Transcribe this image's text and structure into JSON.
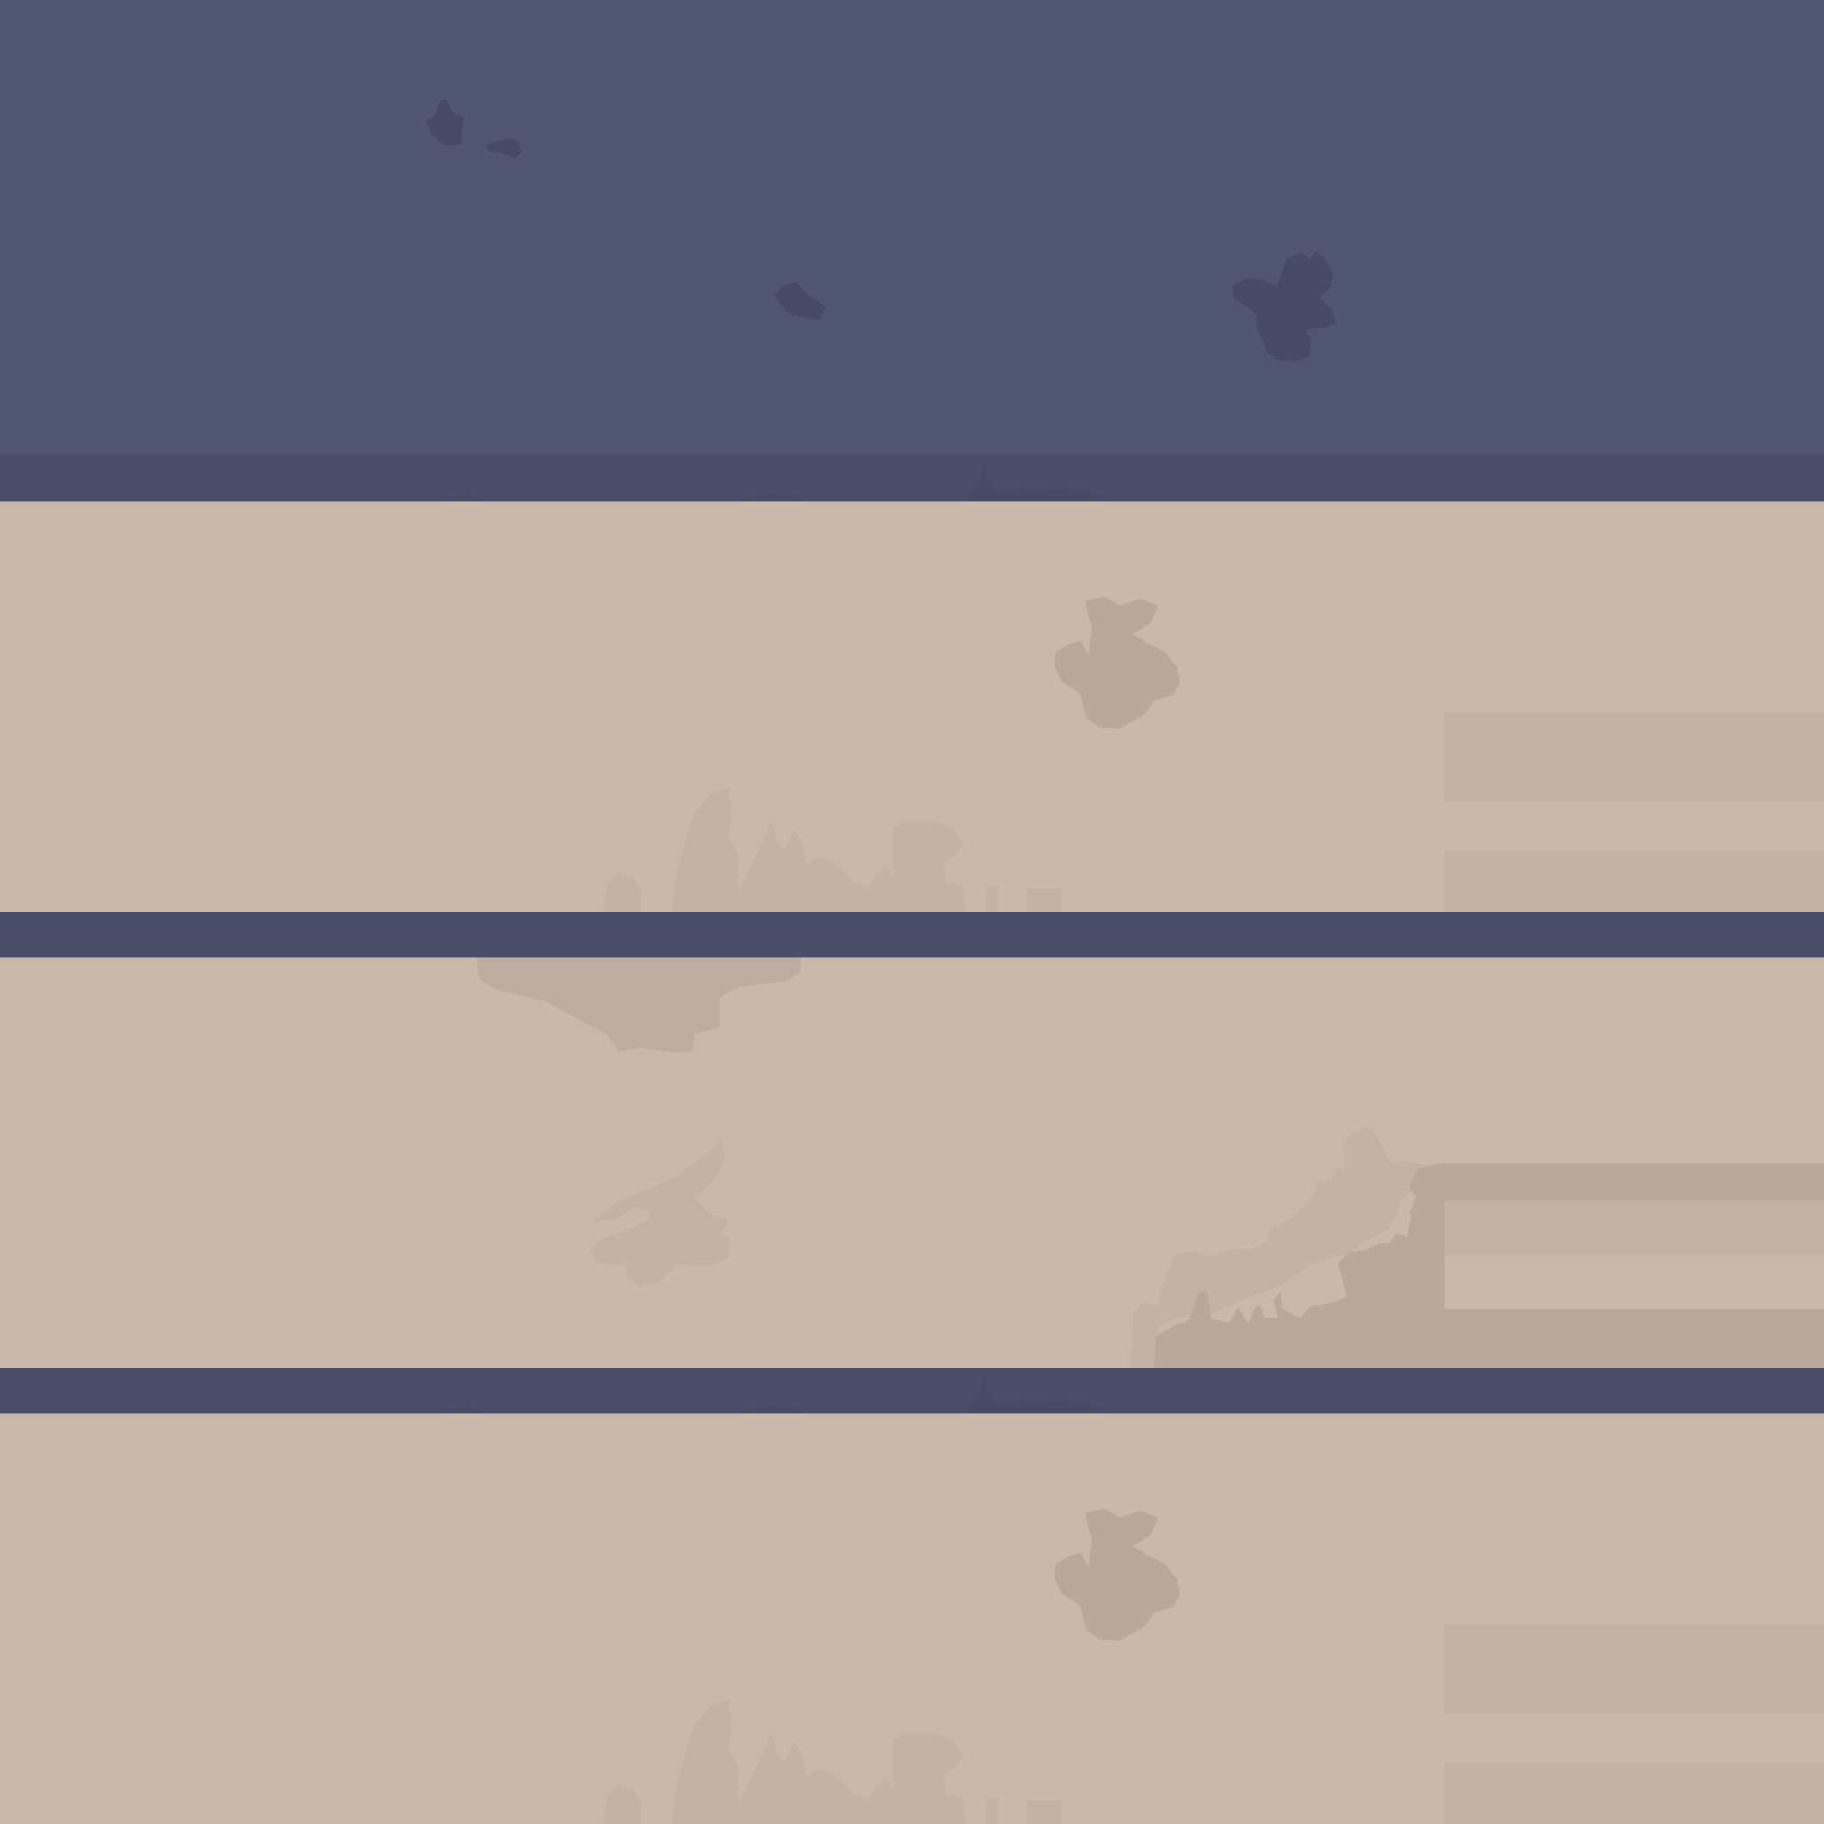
{
  "scene": {
    "type": "tiled-background-texture",
    "palette": {
      "sky": "#51566f",
      "sky_band": "#4b4d69",
      "sky_shadow": "#474a63",
      "sand": "#c9b9ab",
      "sand_shadow": "#bdada0",
      "sand_stripe": "#c3b2a5",
      "rock": "#baa99b"
    },
    "tiles": [
      "sky-tile",
      "sand-tile",
      "sand-tile",
      "sand-tile"
    ],
    "elements": [
      "sky-cloud",
      "sand-cloud",
      "ruin-silhouette",
      "rock-formation",
      "horizon-strip",
      "tiled-stripe"
    ]
  }
}
